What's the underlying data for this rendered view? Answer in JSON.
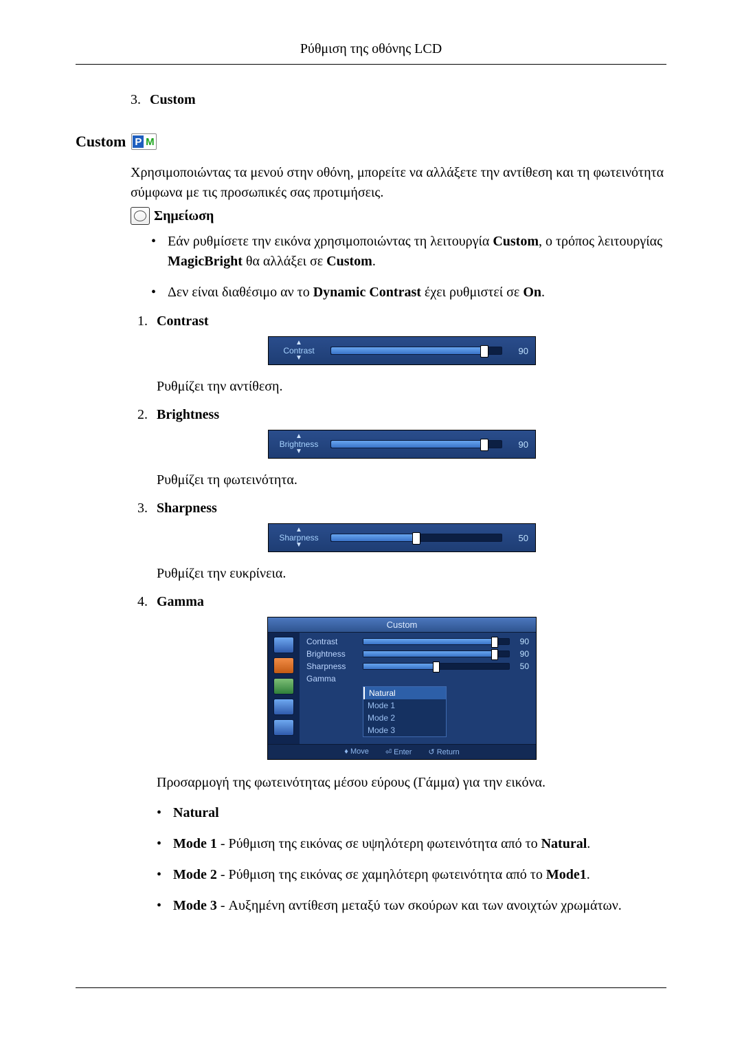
{
  "header": {
    "title": "Ρύθμιση της οθόνης LCD"
  },
  "preceding_item": {
    "num": "3.",
    "label": "Custom"
  },
  "section": {
    "title": "Custom",
    "badge": {
      "p": "P",
      "m": "M"
    },
    "intro": "Χρησιμοποιώντας τα μενού στην οθόνη, μπορείτε να αλλάξετε την αντίθεση και τη φωτεινότητα σύμφωνα με τις προσωπικές σας προτιμήσεις.",
    "note_label": "Σημείωση",
    "notes": [
      {
        "pre": "Εάν ρυθμίσετε την εικόνα χρησιμοποιώντας τη λειτουργία ",
        "b1": "Custom",
        "mid": ", ο τρόπος λειτουργίας ",
        "b2": "MagicBright",
        "mid2": " θα αλλάξει σε ",
        "b3": "Custom",
        "post": "."
      },
      {
        "pre": "Δεν είναι διαθέσιμο αν το ",
        "b1": "Dynamic Contrast",
        "mid": " έχει ρυθμιστεί σε ",
        "b2": "On",
        "post": "."
      }
    ]
  },
  "items": [
    {
      "num": "1.",
      "title": "Contrast",
      "slider": {
        "label": "Contrast",
        "value": 90,
        "pct": 90
      },
      "desc": "Ρυθμίζει την αντίθεση."
    },
    {
      "num": "2.",
      "title": "Brightness",
      "slider": {
        "label": "Brightness",
        "value": 90,
        "pct": 90
      },
      "desc": "Ρυθμίζει τη φωτεινότητα."
    },
    {
      "num": "3.",
      "title": "Sharpness",
      "slider": {
        "label": "Sharpness",
        "value": 50,
        "pct": 50
      },
      "desc": "Ρυθμίζει την ευκρίνεια."
    },
    {
      "num": "4.",
      "title": "Gamma",
      "desc": "Προσαρμογή της φωτεινότητας μέσου εύρους (Γάμμα) για την εικόνα."
    }
  ],
  "gamma_menu": {
    "title": "Custom",
    "rows": [
      {
        "label": "Contrast",
        "value": 90,
        "pct": 90
      },
      {
        "label": "Brightness",
        "value": 90,
        "pct": 90
      },
      {
        "label": "Sharpness",
        "value": 50,
        "pct": 50
      }
    ],
    "gamma_label": "Gamma",
    "options": [
      {
        "label": "Natural",
        "selected": true
      },
      {
        "label": "Mode 1",
        "selected": false
      },
      {
        "label": "Mode 2",
        "selected": false
      },
      {
        "label": "Mode 3",
        "selected": false
      }
    ],
    "footer": {
      "move": "Move",
      "enter": "Enter",
      "return": "Return"
    }
  },
  "gamma_bullets": [
    {
      "b": "Natural",
      "rest": ""
    },
    {
      "b": "Mode 1",
      "rest": " - Ρύθμιση της εικόνας σε υψηλότερη φωτεινότητα από το ",
      "b2": "Natural",
      "tail": "."
    },
    {
      "b": "Mode 2",
      "rest": " - Ρύθμιση της εικόνας σε χαμηλότερη φωτεινότητα από το ",
      "b2": "Mode1",
      "tail": "."
    },
    {
      "b": "Mode 3",
      "rest": " - Αυξημένη αντίθεση μεταξύ των σκούρων και των ανοιχτών χρωμάτων.",
      "b2": "",
      "tail": ""
    }
  ]
}
